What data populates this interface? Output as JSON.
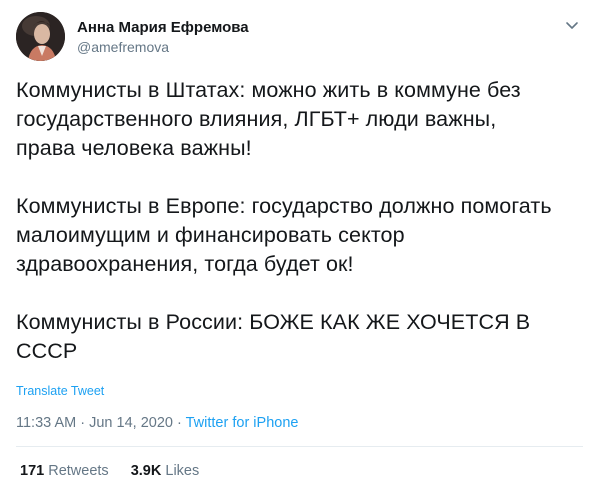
{
  "author": {
    "display_name": "Анна Мария Ефремова",
    "handle": "@amefremova"
  },
  "tweet": {
    "text": "Коммунисты в Штатах: можно жить в коммуне без\nгосударственного влияния, ЛГБТ+ люди важны,\nправа человека важны!\n\nКоммунисты в Европе: государство должно помогать\nмалоимущим и финансировать сектор\nздравоохранения, тогда будет ок!\n\nКоммунисты в России: БОЖЕ КАК ЖЕ ХОЧЕТСЯ В\nСССР",
    "translate_label": "Translate Tweet",
    "time": "11:33 AM",
    "date": "Jun 14, 2020",
    "separator": "·",
    "source": "Twitter for iPhone"
  },
  "stats": {
    "retweets_count": "171",
    "retweets_label": "Retweets",
    "likes_count": "3.9K",
    "likes_label": "Likes"
  },
  "icons": {
    "caret": "chevron-down-icon",
    "avatar": "avatar"
  },
  "colors": {
    "link": "#1da1f2",
    "muted": "#657786",
    "text": "#14171a",
    "divider": "#e6ecf0"
  }
}
